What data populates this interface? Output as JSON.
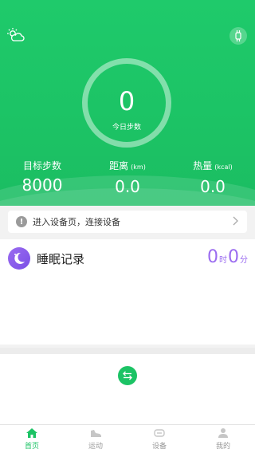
{
  "hero": {
    "steps_value": "0",
    "steps_label": "今日步数",
    "stats": [
      {
        "label": "目标步数",
        "unit": "",
        "value": "8000"
      },
      {
        "label": "距离",
        "unit": "(km)",
        "value": "0.0"
      },
      {
        "label": "热量",
        "unit": "(kcal)",
        "value": "0.0"
      }
    ]
  },
  "device_bar": {
    "text": "进入设备页，连接设备"
  },
  "sleep": {
    "title": "睡眠记录",
    "hours": "0",
    "hours_unit": "时",
    "minutes": "0",
    "minutes_unit": "分"
  },
  "tabs": [
    {
      "label": "首页",
      "icon": "home-icon",
      "active": true
    },
    {
      "label": "运动",
      "icon": "shoe-icon",
      "active": false
    },
    {
      "label": "设备",
      "icon": "device-icon",
      "active": false
    },
    {
      "label": "我的",
      "icon": "person-icon",
      "active": false
    }
  ],
  "colors": {
    "accent": "#1cc365",
    "sleep": "#9b6cf0"
  }
}
